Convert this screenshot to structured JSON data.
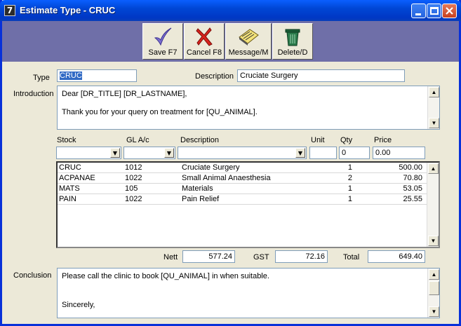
{
  "window": {
    "title": "Estimate Type - CRUC",
    "icon_glyph": "7"
  },
  "toolbar": {
    "save": "Save F7",
    "cancel": "Cancel F8",
    "message": "Message/M",
    "delete": "Delete/D"
  },
  "form": {
    "type_label": "Type",
    "type_value": "CRUC",
    "description_label": "Description",
    "description_value": "Cruciate Surgery",
    "introduction_label": "Introduction",
    "introduction_lines": [
      "Dear [DR_TITLE] [DR_LASTNAME],",
      "Thank you for your query on treatment for [QU_ANIMAL]."
    ],
    "conclusion_label": "Conclusion",
    "conclusion_lines": [
      "Please call the clinic to book [QU_ANIMAL] in when suitable.",
      "Sincerely,"
    ]
  },
  "grid_headers": {
    "stock": "Stock",
    "gl": "GL A/c",
    "description": "Description",
    "unit": "Unit",
    "qty": "Qty",
    "price": "Price"
  },
  "entry_row": {
    "stock": "",
    "gl": "",
    "description": "",
    "unit": "",
    "qty": "0",
    "price": "0.00"
  },
  "rows": [
    {
      "stock": "CRUC",
      "gl": "1012",
      "description": "Cruciate Surgery",
      "qty": "1",
      "price": "500.00"
    },
    {
      "stock": "ACPANAE",
      "gl": "1022",
      "description": "Small Animal Anaesthesia",
      "qty": "2",
      "price": "70.80"
    },
    {
      "stock": "MATS",
      "gl": "105",
      "description": "Materials",
      "qty": "1",
      "price": "53.05"
    },
    {
      "stock": "PAIN",
      "gl": "1022",
      "description": "Pain Relief",
      "qty": "1",
      "price": "25.55"
    }
  ],
  "totals": {
    "nett_label": "Nett",
    "nett_value": "577.24",
    "gst_label": "GST",
    "gst_value": "72.16",
    "total_label": "Total",
    "total_value": "649.40"
  },
  "colors": {
    "titlebar": "#0046d5",
    "toolbar_band": "#6f6fa8",
    "selection": "#316ac5"
  }
}
